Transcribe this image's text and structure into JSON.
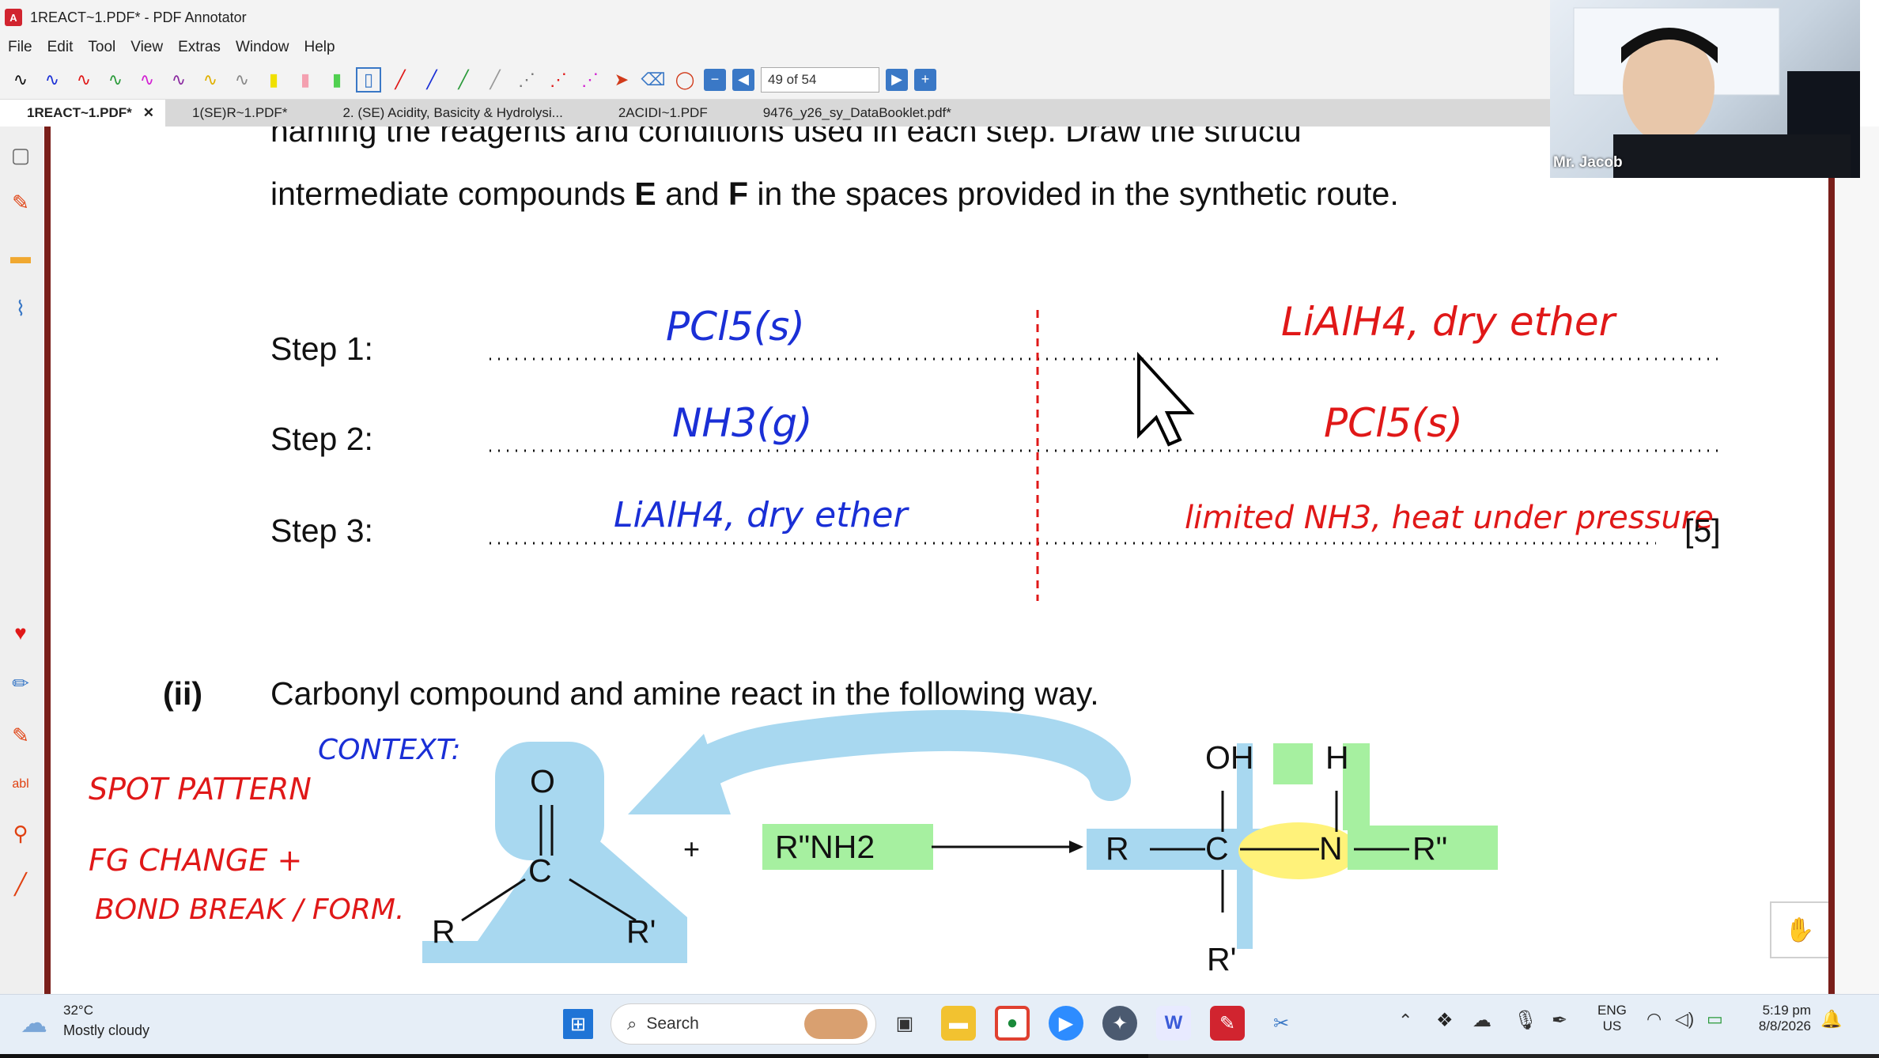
{
  "window": {
    "title": "1REACT~1.PDF* - PDF Annotator"
  },
  "menu": [
    "File",
    "Edit",
    "Tool",
    "View",
    "Extras",
    "Window",
    "Help"
  ],
  "toolbar": {
    "page_indicator": "49 of 54"
  },
  "tabs": [
    {
      "label": "1REACT~1.PDF*",
      "active": true,
      "close": "✕"
    },
    {
      "label": "1(SE)R~1.PDF*"
    },
    {
      "label": "2. (SE) Acidity, Basicity & Hydrolysi..."
    },
    {
      "label": "2ACIDI~1.PDF"
    },
    {
      "label": "9476_y26_sy_DataBooklet.pdf*"
    }
  ],
  "document": {
    "intro_line1": "naming the reagents and conditions used in each step. Draw the structu",
    "intro_line2_a": "intermediate compounds ",
    "intro_E": "E",
    "intro_and": " and ",
    "intro_F": "F",
    "intro_line2_b": " in the spaces provided in the synthetic route.",
    "steps": [
      {
        "label": "Step 1:",
        "left": "PCl5(s)",
        "right": "LiAlH4, dry ether"
      },
      {
        "label": "Step 2:",
        "left": "NH3(g)",
        "right": "PCl5(s)"
      },
      {
        "label": "Step 3:",
        "left": "LiAlH4, dry ether",
        "right": "limited NH3, heat under pressure"
      }
    ],
    "marks": "[5]",
    "part": "(ii)",
    "part_text": "Carbonyl compound and amine react in the following way.",
    "reaction": {
      "carbonyl_O": "O",
      "carbonyl_C": "C",
      "R": "R",
      "R_prime": "R'",
      "plus": "+",
      "amine": "R\"NH2",
      "product_OH": "OH",
      "product_H": "H",
      "product_R": "R",
      "product_C": "C",
      "product_N": "N",
      "product_R2": "R\"",
      "product_Rprime": "R'"
    }
  },
  "annotations": {
    "context": "CONTEXT:",
    "spot_pattern": "SPOT PATTERN",
    "fg_change": "FG CHANGE +",
    "bond_break": "BOND BREAK / FORM."
  },
  "webcam": {
    "name": "Mr. Jacob"
  },
  "taskbar": {
    "weather_temp": "32°C",
    "weather_desc": "Mostly cloudy",
    "search": "Search",
    "lang_top": "ENG",
    "lang_bottom": "US",
    "time": "5:19 pm",
    "date": "8/8/2026"
  },
  "colors": {
    "blue_ink": "#1a2fd6",
    "red_ink": "#e01818",
    "highlight_blue": "#a8d8f0",
    "highlight_green": "#a6f0a0",
    "highlight_yellow": "#fff27a",
    "frame": "#7a1f1a"
  }
}
